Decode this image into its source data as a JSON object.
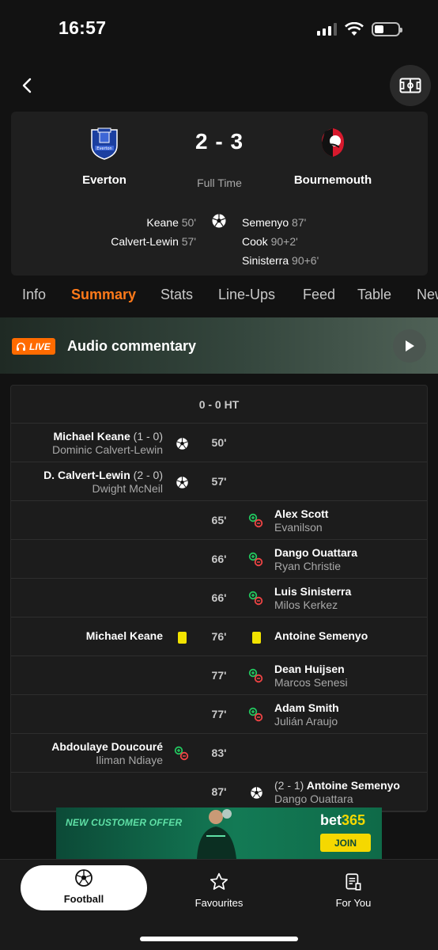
{
  "status_bar": {
    "time": "16:57"
  },
  "match": {
    "home": {
      "name": "Everton",
      "crest_text": "Everton"
    },
    "away": {
      "name": "Bournemouth"
    },
    "score": "2 - 3",
    "status": "Full Time",
    "home_scorers": [
      {
        "name": "Keane",
        "minute": "50'"
      },
      {
        "name": "Calvert-Lewin",
        "minute": "57'"
      }
    ],
    "away_scorers": [
      {
        "name": "Semenyo",
        "minute": "87'"
      },
      {
        "name": "Cook",
        "minute": "90+2'"
      },
      {
        "name": "Sinisterra",
        "minute": "90+6'"
      }
    ]
  },
  "tabs": [
    "Info",
    "Summary",
    "Stats",
    "Line-Ups",
    "Feed",
    "Table",
    "News"
  ],
  "active_tab": "Summary",
  "audio": {
    "badge": "LIVE",
    "title": "Audio commentary"
  },
  "summary": {
    "half_time": "0 - 0 HT",
    "events": [
      {
        "minute": "50'",
        "home_main": "Michael Keane",
        "home_paren": "(1 - 0)",
        "home_sub": "Dominic Calvert-Lewin"
      },
      {
        "minute": "57'",
        "home_main": "D. Calvert-Lewin",
        "home_paren": "(2 - 0)",
        "home_sub": "Dwight McNeil"
      },
      {
        "minute": "65'",
        "away_main": "Alex Scott",
        "away_sub": "Evanilson"
      },
      {
        "minute": "66'",
        "away_main": "Dango Ouattara",
        "away_sub": "Ryan Christie"
      },
      {
        "minute": "66'",
        "away_main": "Luis Sinisterra",
        "away_sub": "Milos Kerkez"
      },
      {
        "minute": "76'",
        "home_main": "Michael Keane",
        "away_main": "Antoine Semenyo"
      },
      {
        "minute": "77'",
        "away_main": "Dean Huijsen",
        "away_sub": "Marcos Senesi"
      },
      {
        "minute": "77'",
        "away_main": "Adam Smith",
        "away_sub": "Julián Araujo"
      },
      {
        "minute": "83'",
        "home_main": "Abdoulaye Doucouré",
        "home_sub": "Iliman Ndiaye"
      },
      {
        "minute": "87'",
        "away_paren": "(2 - 1)",
        "away_main": "Antoine Semenyo",
        "away_sub": "Dango Ouattara"
      }
    ]
  },
  "ad": {
    "offer": "NEW CUSTOMER OFFER",
    "brand_a": "bet",
    "brand_b": "365",
    "cta": "JOIN"
  },
  "nav": {
    "football": "Football",
    "favourites": "Favourites",
    "for_you": "For You"
  },
  "colors": {
    "accent": "#ff7a1a",
    "live": "#ff6b00",
    "yellow_card": "#f2e300",
    "sub_in": "#22c55e",
    "sub_out": "#ef4444"
  }
}
